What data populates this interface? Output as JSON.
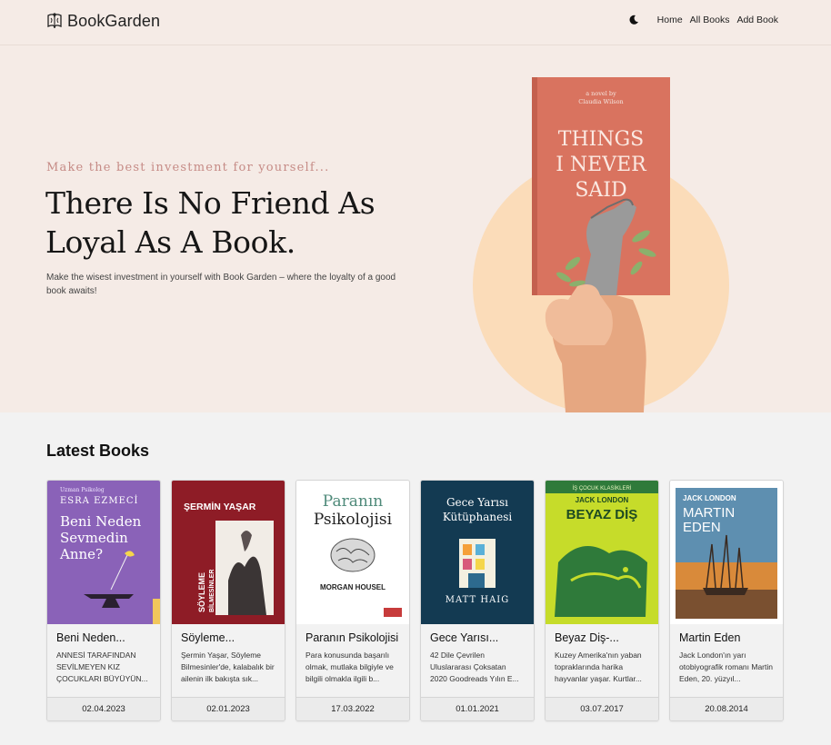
{
  "navbar": {
    "brand": "BookGarden",
    "links": [
      "Home",
      "All Books",
      "Add Book"
    ]
  },
  "hero": {
    "tagline": "Make the best investment for yourself...",
    "headline": "There Is No Friend As Loyal As A Book.",
    "subtitle": "Make the wisest investment in yourself with Book Garden – where the loyalty of a good book awaits!",
    "book": {
      "author_line1": "a novel by",
      "author_line2": "Claudia Wilson",
      "title_line1": "THINGS",
      "title_line2": "I NEVER",
      "title_line3": "SAID"
    }
  },
  "latest": {
    "title": "Latest Books",
    "books": [
      {
        "title": "Beni Neden...",
        "description": "ANNESİ TARAFINDAN SEVİLMEYEN KIZ ÇOCUKLARI BÜYÜYÜN...",
        "date": "02.04.2023",
        "cover": {
          "top": "Uzman Psikolog",
          "author": "ESRA EZMECİ",
          "t1": "Beni Neden",
          "t2": "Sevmedin",
          "t3": "Anne?",
          "bg": "#8a62b8"
        }
      },
      {
        "title": "Söyleme...",
        "description": "Şermin Yaşar, Söyleme Bilmesinler'de, kalabalık bir ailenin ilk bakışta sık...",
        "date": "02.01.2023",
        "cover": {
          "author": "ŞERMİN YAŞAR",
          "t1": "SÖYLEME",
          "t2": "BİLMESİNLER",
          "bg": "#8e1c26"
        }
      },
      {
        "title": "Paranın Psikolojisi",
        "description": "Para konusunda başarılı olmak, mutlaka bilgiyle ve bilgili olmakla ilgili b...",
        "date": "17.03.2022",
        "cover": {
          "t1": "Paranın",
          "t2": "Psikolojisi",
          "author": "MORGAN HOUSEL",
          "bg": "#ffffff"
        }
      },
      {
        "title": "Gece Yarısı...",
        "description": "42 Dile Çevrilen Uluslararası Çoksatan 2020 Goodreads Yılın E...",
        "date": "01.01.2021",
        "cover": {
          "t1": "Gece Yarısı",
          "t2": "Kütüphanesi",
          "author": "MATT HAIG",
          "bg": "#133a52"
        }
      },
      {
        "title": "Beyaz Diş-...",
        "description": "Kuzey Amerika'nın yaban topraklarında harika hayvanlar yaşar. Kurtlar...",
        "date": "03.07.2017",
        "cover": {
          "top": "İŞ ÇOCUK KLASİKLERİ",
          "author": "JACK LONDON",
          "t1": "BEYAZ DİŞ",
          "bg": "#c6dc2a"
        }
      },
      {
        "title": "Martin Eden",
        "description": "Jack London'ın yarı otobiyografik romanı Martin Eden, 20. yüzyıl...",
        "date": "20.08.2014",
        "cover": {
          "author": "JACK LONDON",
          "t1": "MARTIN",
          "t2": "EDEN",
          "bg": "#5e8fb0"
        }
      }
    ]
  }
}
